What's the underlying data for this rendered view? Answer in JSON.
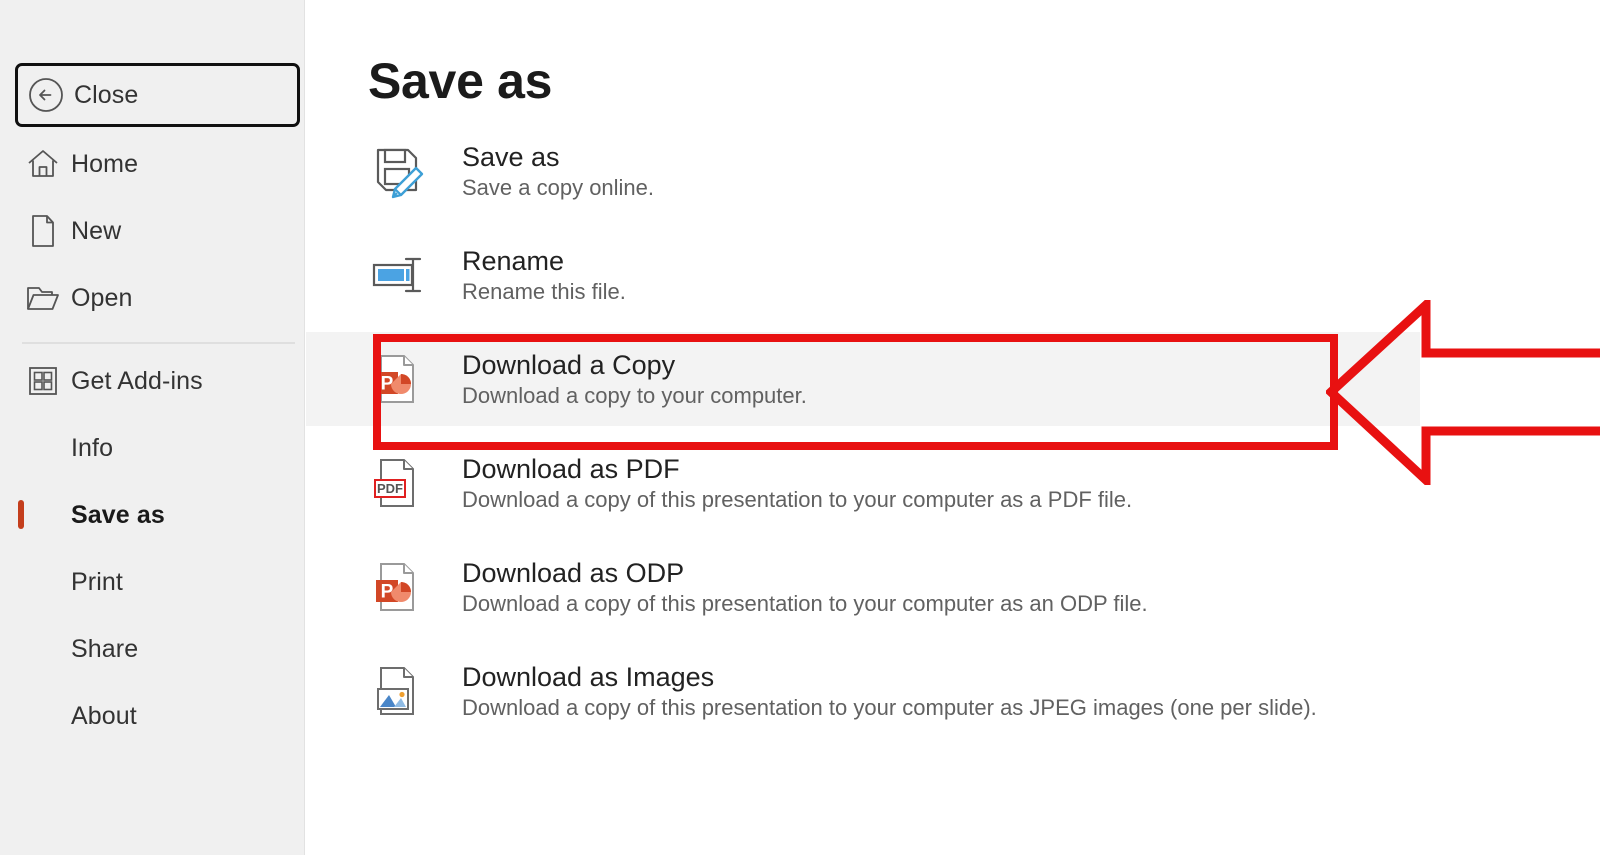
{
  "sidebar": {
    "close": {
      "label": "Close",
      "icon": "back-circle-arrow-icon"
    },
    "items": [
      {
        "label": "Home",
        "icon": "home-icon"
      },
      {
        "label": "New",
        "icon": "new-document-icon"
      },
      {
        "label": "Open",
        "icon": "open-folder-icon"
      },
      {
        "label": "Get Add-ins",
        "icon": "add-ins-grid-icon"
      },
      {
        "label": "Info",
        "icon": ""
      },
      {
        "label": "Save as",
        "icon": ""
      },
      {
        "label": "Print",
        "icon": ""
      },
      {
        "label": "Share",
        "icon": ""
      },
      {
        "label": "About",
        "icon": ""
      }
    ],
    "active_item": "Save as",
    "active_marker_color": "#c43e1c"
  },
  "main": {
    "title": "Save as",
    "options": [
      {
        "title": "Save as",
        "subtitle": "Save a copy online.",
        "icon": "save-floppy-pencil-icon"
      },
      {
        "title": "Rename",
        "subtitle": "Rename this file.",
        "icon": "rename-textbox-icon"
      },
      {
        "title": "Download a Copy",
        "subtitle": "Download a copy to your computer.",
        "icon": "powerpoint-document-icon"
      },
      {
        "title": "Download as PDF",
        "subtitle": "Download a copy of this presentation to your computer as a PDF file.",
        "icon": "pdf-document-icon"
      },
      {
        "title": "Download as ODP",
        "subtitle": "Download a copy of this presentation to your computer as an ODP file.",
        "icon": "powerpoint-document-icon"
      },
      {
        "title": "Download as Images",
        "subtitle": "Download a copy of this presentation to your computer as JPEG images (one per slide).",
        "icon": "image-document-icon"
      }
    ],
    "highlighted_option": "Download a Copy"
  },
  "annotations": {
    "highlight_color": "#e81111",
    "arrow_color": "#e81111",
    "arrow_direction": "left",
    "arrow_points_to": "Download a Copy"
  }
}
